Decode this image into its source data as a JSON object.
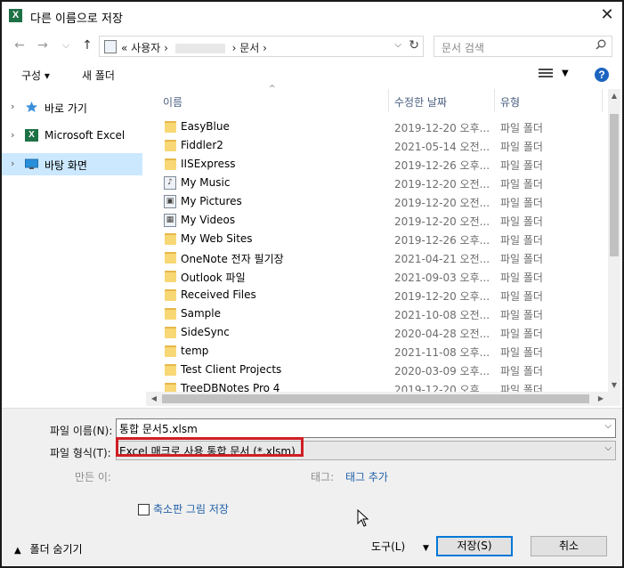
{
  "window": {
    "title": "다른 이름으로 저장",
    "app_icon": "X"
  },
  "nav": {
    "back_icon": "←",
    "forward_icon": "→",
    "dropdown_icon": "⌵",
    "up_icon": "↑",
    "breadcrumb": {
      "prefix": "«",
      "part1": "사용자",
      "sep": "›",
      "part2": "문서"
    },
    "refresh_icon": "↻",
    "search_placeholder": "문서 검색"
  },
  "toolbar": {
    "organize": "구성 ▾",
    "new_folder": "새 폴더",
    "help": "?"
  },
  "tree": [
    {
      "label": "바로 가기",
      "icon": "star-icon"
    },
    {
      "label": "Microsoft Excel",
      "icon": "excel-icon"
    },
    {
      "label": "바탕 화면",
      "icon": "desktop-icon",
      "selected": true
    }
  ],
  "columns": {
    "name": "이름",
    "date": "수정한 날짜",
    "type": "유형"
  },
  "files": [
    {
      "name": "EasyBlue",
      "date": "2019-12-20 오후...",
      "type": "파일 폴더",
      "icon": "folder"
    },
    {
      "name": "Fiddler2",
      "date": "2021-05-14 오전...",
      "type": "파일 폴더",
      "icon": "folder"
    },
    {
      "name": "IISExpress",
      "date": "2019-12-26 오후...",
      "type": "파일 폴더",
      "icon": "folder"
    },
    {
      "name": "My Music",
      "date": "2019-12-20 오전...",
      "type": "파일 폴더",
      "icon": "music"
    },
    {
      "name": "My Pictures",
      "date": "2019-12-20 오전...",
      "type": "파일 폴더",
      "icon": "pictures"
    },
    {
      "name": "My Videos",
      "date": "2019-12-20 오전...",
      "type": "파일 폴더",
      "icon": "videos"
    },
    {
      "name": "My Web Sites",
      "date": "2019-12-26 오후...",
      "type": "파일 폴더",
      "icon": "folder"
    },
    {
      "name": "OneNote 전자 필기장",
      "date": "2021-04-21 오전...",
      "type": "파일 폴더",
      "icon": "folder"
    },
    {
      "name": "Outlook 파일",
      "date": "2021-09-03 오후...",
      "type": "파일 폴더",
      "icon": "folder"
    },
    {
      "name": "Received Files",
      "date": "2019-12-20 오후...",
      "type": "파일 폴더",
      "icon": "folder"
    },
    {
      "name": "Sample",
      "date": "2021-10-08 오전...",
      "type": "파일 폴더",
      "icon": "folder"
    },
    {
      "name": "SideSync",
      "date": "2020-04-28 오전...",
      "type": "파일 폴더",
      "icon": "folder"
    },
    {
      "name": "temp",
      "date": "2021-11-08 오후...",
      "type": "파일 폴더",
      "icon": "folder"
    },
    {
      "name": "Test Client Projects",
      "date": "2020-03-09 오후...",
      "type": "파일 폴더",
      "icon": "folder"
    },
    {
      "name": "TreeDBNotes Pro 4",
      "date": "2019-12-20 오후...",
      "type": "파일 폴더",
      "icon": "folder"
    }
  ],
  "form": {
    "filename_label": "파일 이름(N):",
    "filename_value": "통합 문서5.xlsm",
    "filetype_label": "파일 형식(T):",
    "filetype_value": "Excel 매크로 사용 통합 문서 (*.xlsm)",
    "author_label": "만든 이:",
    "tags_label": "태그:",
    "tags_link": "태그 추가",
    "thumbnail_label": "축소판 그림 저장"
  },
  "footer": {
    "hide_folders": "폴더 숨기기",
    "tools": "도구(L)",
    "save": "저장(S)",
    "cancel": "취소"
  },
  "colors": {
    "highlight_box": "#d01e24",
    "selection": "#cce8ff",
    "link": "#1e5fa8"
  }
}
